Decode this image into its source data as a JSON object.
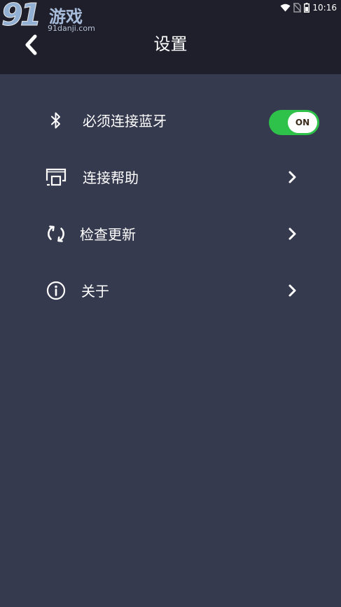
{
  "status_bar": {
    "time": "10:16"
  },
  "watermark": {
    "number": "91",
    "name": "游戏",
    "domain": "91danji.com"
  },
  "header": {
    "title": "设置"
  },
  "settings": {
    "items": [
      {
        "label": "必须连接蓝牙",
        "icon": "bluetooth-icon",
        "control": "toggle",
        "toggle_text": "ON",
        "toggle_on": true
      },
      {
        "label": "连接帮助",
        "icon": "screen-cast-icon",
        "control": "chevron"
      },
      {
        "label": "检查更新",
        "icon": "refresh-icon",
        "control": "chevron"
      },
      {
        "label": "关于",
        "icon": "info-icon",
        "control": "chevron"
      }
    ]
  },
  "colors": {
    "background": "#363a4f",
    "header_background": "#1e1f2a",
    "toggle_on": "#2ec24a",
    "text": "#ffffff"
  }
}
